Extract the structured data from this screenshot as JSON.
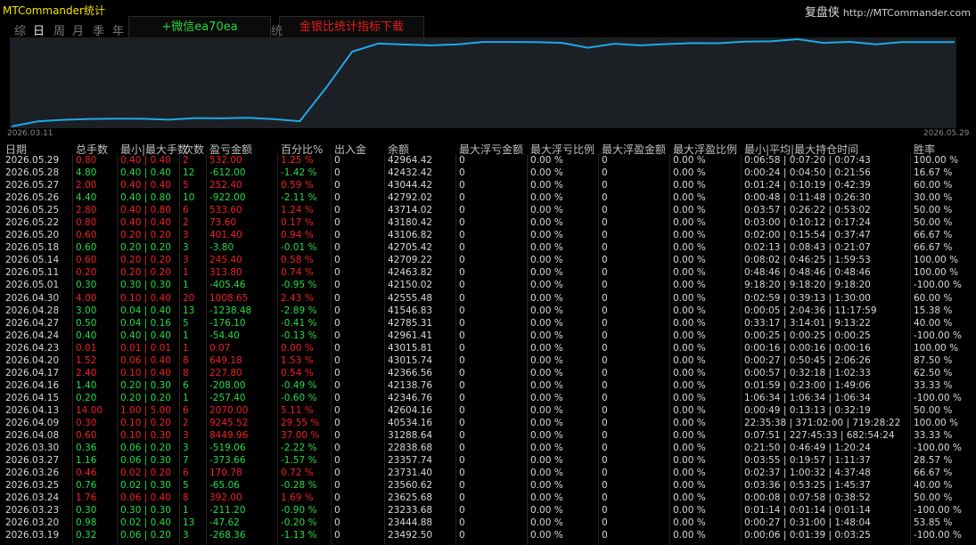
{
  "app": {
    "title": "MTCommander统计"
  },
  "brand": {
    "name": "复盘侠",
    "url": "http://MTCommander.com"
  },
  "period_tabs": [
    "综",
    "日",
    "周",
    "月",
    "季",
    "年"
  ],
  "active_tab": "日",
  "banners": {
    "wechat": "+微信ea70ea",
    "download": "金银比统计指标下载"
  },
  "hidden_tab_fragment": "统",
  "chart": {
    "start_date": "2026.03.11",
    "end_date": "2026.05.29",
    "line_color": "#1fa8e8"
  },
  "chart_data": {
    "type": "line",
    "x": [
      "2026.03.11",
      "2026.03.12",
      "2026.03.13",
      "2026.03.16",
      "2026.03.17",
      "2026.03.18",
      "2026.03.19",
      "2026.03.20",
      "2026.03.23",
      "2026.03.24",
      "2026.03.25",
      "2026.03.26",
      "2026.03.27",
      "2026.03.30",
      "2026.04.08",
      "2026.04.09",
      "2026.04.13",
      "2026.04.15",
      "2026.04.16",
      "2026.04.17",
      "2026.04.20",
      "2026.04.23",
      "2026.04.24",
      "2026.04.27",
      "2026.04.28",
      "2026.04.30",
      "2026.05.01",
      "2026.05.11",
      "2026.05.14",
      "2026.05.18",
      "2026.05.20",
      "2026.05.22",
      "2026.05.25",
      "2026.05.26",
      "2026.05.27",
      "2026.05.28",
      "2026.05.29"
    ],
    "series": [
      {
        "values": [
          21500,
          22800,
          23200,
          23400,
          23492,
          23445,
          23234,
          23626,
          23561,
          23731,
          23358,
          22839,
          31289,
          40534,
          42604,
          42347,
          42139,
          42367,
          43016,
          43016,
          42961,
          42785,
          41547,
          42555,
          42150,
          42464,
          42709,
          42705,
          43107,
          43181,
          43714,
          42792,
          43044,
          42432,
          42964,
          42964,
          42964
        ]
      }
    ],
    "xlabel": "",
    "ylabel": ""
  },
  "headers": [
    "日期",
    "总手数",
    "最小|最大手数",
    "次数",
    "盈亏金额",
    "百分比%",
    "出入金",
    "余额",
    "最大浮亏金额",
    "最大浮亏比例",
    "最大浮盈金额",
    "最大浮盈比例",
    "最小|平均|最大持仓时间",
    "胜率"
  ],
  "rows": [
    {
      "date": "2026.05.29",
      "lots": "0.80",
      "minmax": "0.40 | 0.40",
      "count": "2",
      "pnl": "532.00",
      "pct": "1.25 %",
      "io": "0",
      "balance": "42964.42",
      "mfl": "0",
      "mflp": "0.00 %",
      "mfp": "0",
      "mfpp": "0.00 %",
      "hold": "0:06:58 | 0:07:20 | 0:07:43",
      "win": "100.00 %",
      "dir": "up"
    },
    {
      "date": "2026.05.28",
      "lots": "4.80",
      "minmax": "0.40 | 0.40",
      "count": "12",
      "pnl": "-612.00",
      "pct": "-1.42 %",
      "io": "0",
      "balance": "42432.42",
      "mfl": "0",
      "mflp": "0.00 %",
      "mfp": "0",
      "mfpp": "0.00 %",
      "hold": "0:00:24 | 0:04:50 | 0:21:56",
      "win": "16.67 %",
      "dir": "down"
    },
    {
      "date": "2026.05.27",
      "lots": "2.00",
      "minmax": "0.40 | 0.40",
      "count": "5",
      "pnl": "252.40",
      "pct": "0.59 %",
      "io": "0",
      "balance": "43044.42",
      "mfl": "0",
      "mflp": "0.00 %",
      "mfp": "0",
      "mfpp": "0.00 %",
      "hold": "0:01:24 | 0:10:19 | 0:42:39",
      "win": "60.00 %",
      "dir": "up"
    },
    {
      "date": "2026.05.26",
      "lots": "4.40",
      "minmax": "0.40 | 0.80",
      "count": "10",
      "pnl": "-922.00",
      "pct": "-2.11 %",
      "io": "0",
      "balance": "42792.02",
      "mfl": "0",
      "mflp": "0.00 %",
      "mfp": "0",
      "mfpp": "0.00 %",
      "hold": "0:00:48 | 0:11:48 | 0:26:30",
      "win": "30.00 %",
      "dir": "down"
    },
    {
      "date": "2026.05.25",
      "lots": "2.80",
      "minmax": "0.40 | 0.80",
      "count": "6",
      "pnl": "533.60",
      "pct": "1.24 %",
      "io": "0",
      "balance": "43714.02",
      "mfl": "0",
      "mflp": "0.00 %",
      "mfp": "0",
      "mfpp": "0.00 %",
      "hold": "0:03:57 | 0:26:22 | 0:53:02",
      "win": "50.00 %",
      "dir": "up"
    },
    {
      "date": "2026.05.22",
      "lots": "0.80",
      "minmax": "0.40 | 0.40",
      "count": "2",
      "pnl": "73.60",
      "pct": "0.17 %",
      "io": "0",
      "balance": "43180.42",
      "mfl": "0",
      "mflp": "0.00 %",
      "mfp": "0",
      "mfpp": "0.00 %",
      "hold": "0:03:00 | 0:10:12 | 0:17:24",
      "win": "50.00 %",
      "dir": "up"
    },
    {
      "date": "2026.05.20",
      "lots": "0.60",
      "minmax": "0.20 | 0.20",
      "count": "3",
      "pnl": "401.40",
      "pct": "0.94 %",
      "io": "0",
      "balance": "43106.82",
      "mfl": "0",
      "mflp": "0.00 %",
      "mfp": "0",
      "mfpp": "0.00 %",
      "hold": "0:02:00 | 0:15:54 | 0:37:47",
      "win": "66.67 %",
      "dir": "up"
    },
    {
      "date": "2026.05.18",
      "lots": "0.60",
      "minmax": "0.20 | 0.20",
      "count": "3",
      "pnl": "-3.80",
      "pct": "-0.01 %",
      "io": "0",
      "balance": "42705.42",
      "mfl": "0",
      "mflp": "0.00 %",
      "mfp": "0",
      "mfpp": "0.00 %",
      "hold": "0:02:13 | 0:08:43 | 0:21:07",
      "win": "66.67 %",
      "dir": "down"
    },
    {
      "date": "2026.05.14",
      "lots": "0.60",
      "minmax": "0.20 | 0.20",
      "count": "3",
      "pnl": "245.40",
      "pct": "0.58 %",
      "io": "0",
      "balance": "42709.22",
      "mfl": "0",
      "mflp": "0.00 %",
      "mfp": "0",
      "mfpp": "0.00 %",
      "hold": "0:08:02 | 0:46:25 | 1:59:53",
      "win": "100.00 %",
      "dir": "up"
    },
    {
      "date": "2026.05.11",
      "lots": "0.20",
      "minmax": "0.20 | 0.20",
      "count": "1",
      "pnl": "313.80",
      "pct": "0.74 %",
      "io": "0",
      "balance": "42463.82",
      "mfl": "0",
      "mflp": "0.00 %",
      "mfp": "0",
      "mfpp": "0.00 %",
      "hold": "0:48:46 | 0:48:46 | 0:48:46",
      "win": "100.00 %",
      "dir": "up"
    },
    {
      "date": "2026.05.01",
      "lots": "0.30",
      "minmax": "0.30 | 0.30",
      "count": "1",
      "pnl": "-405.46",
      "pct": "-0.95 %",
      "io": "0",
      "balance": "42150.02",
      "mfl": "0",
      "mflp": "0.00 %",
      "mfp": "0",
      "mfpp": "0.00 %",
      "hold": "9:18:20 | 9:18:20 | 9:18:20",
      "win": "-100.00 %",
      "dir": "down"
    },
    {
      "date": "2026.04.30",
      "lots": "4.00",
      "minmax": "0.10 | 0.40",
      "count": "20",
      "pnl": "1008.65",
      "pct": "2.43 %",
      "io": "0",
      "balance": "42555.48",
      "mfl": "0",
      "mflp": "0.00 %",
      "mfp": "0",
      "mfpp": "0.00 %",
      "hold": "0:02:59 | 0:39:13 | 1:30:00",
      "win": "60.00 %",
      "dir": "up"
    },
    {
      "date": "2026.04.28",
      "lots": "3.00",
      "minmax": "0.04 | 0.40",
      "count": "13",
      "pnl": "-1238.48",
      "pct": "-2.89 %",
      "io": "0",
      "balance": "41546.83",
      "mfl": "0",
      "mflp": "0.00 %",
      "mfp": "0",
      "mfpp": "0.00 %",
      "hold": "0:00:05 | 2:04:36 | 11:17:59",
      "win": "15.38 %",
      "dir": "down"
    },
    {
      "date": "2026.04.27",
      "lots": "0.50",
      "minmax": "0.04 | 0.16",
      "count": "5",
      "pnl": "-176.10",
      "pct": "-0.41 %",
      "io": "0",
      "balance": "42785.31",
      "mfl": "0",
      "mflp": "0.00 %",
      "mfp": "0",
      "mfpp": "0.00 %",
      "hold": "0:33:17 | 3:14:01 | 9:13:22",
      "win": "40.00 %",
      "dir": "down"
    },
    {
      "date": "2026.04.24",
      "lots": "0.40",
      "minmax": "0.40 | 0.40",
      "count": "1",
      "pnl": "-54.40",
      "pct": "-0.13 %",
      "io": "0",
      "balance": "42961.41",
      "mfl": "0",
      "mflp": "0.00 %",
      "mfp": "0",
      "mfpp": "0.00 %",
      "hold": "0:00:25 | 0:00:25 | 0:00:25",
      "win": "-100.00 %",
      "dir": "down"
    },
    {
      "date": "2026.04.23",
      "lots": "0.01",
      "minmax": "0.01 | 0.01",
      "count": "1",
      "pnl": "0.07",
      "pct": "0.00 %",
      "io": "0",
      "balance": "43015.81",
      "mfl": "0",
      "mflp": "0.00 %",
      "mfp": "0",
      "mfpp": "0.00 %",
      "hold": "0:00:16 | 0:00:16 | 0:00:16",
      "win": "100.00 %",
      "dir": "up"
    },
    {
      "date": "2026.04.20",
      "lots": "1.52",
      "minmax": "0.06 | 0.40",
      "count": "8",
      "pnl": "649.18",
      "pct": "1.53 %",
      "io": "0",
      "balance": "43015.74",
      "mfl": "0",
      "mflp": "0.00 %",
      "mfp": "0",
      "mfpp": "0.00 %",
      "hold": "0:00:27 | 0:50:45 | 2:06:26",
      "win": "87.50 %",
      "dir": "up"
    },
    {
      "date": "2026.04.17",
      "lots": "2.40",
      "minmax": "0.10 | 0.40",
      "count": "8",
      "pnl": "227.80",
      "pct": "0.54 %",
      "io": "0",
      "balance": "42366.56",
      "mfl": "0",
      "mflp": "0.00 %",
      "mfp": "0",
      "mfpp": "0.00 %",
      "hold": "0:00:57 | 0:32:18 | 1:02:33",
      "win": "62.50 %",
      "dir": "up"
    },
    {
      "date": "2026.04.16",
      "lots": "1.40",
      "minmax": "0.20 | 0.30",
      "count": "6",
      "pnl": "-208.00",
      "pct": "-0.49 %",
      "io": "0",
      "balance": "42138.76",
      "mfl": "0",
      "mflp": "0.00 %",
      "mfp": "0",
      "mfpp": "0.00 %",
      "hold": "0:01:59 | 0:23:00 | 1:49:06",
      "win": "33.33 %",
      "dir": "down"
    },
    {
      "date": "2026.04.15",
      "lots": "0.20",
      "minmax": "0.20 | 0.20",
      "count": "1",
      "pnl": "-257.40",
      "pct": "-0.60 %",
      "io": "0",
      "balance": "42346.76",
      "mfl": "0",
      "mflp": "0.00 %",
      "mfp": "0",
      "mfpp": "0.00 %",
      "hold": "1:06:34 | 1:06:34 | 1:06:34",
      "win": "-100.00 %",
      "dir": "down"
    },
    {
      "date": "2026.04.13",
      "lots": "14.00",
      "minmax": "1.00 | 5.00",
      "count": "6",
      "pnl": "2070.00",
      "pct": "5.11 %",
      "io": "0",
      "balance": "42604.16",
      "mfl": "0",
      "mflp": "0.00 %",
      "mfp": "0",
      "mfpp": "0.00 %",
      "hold": "0:00:49 | 0:13:13 | 0:32:19",
      "win": "50.00 %",
      "dir": "up"
    },
    {
      "date": "2026.04.09",
      "lots": "0.30",
      "minmax": "0.10 | 0.20",
      "count": "2",
      "pnl": "9245.52",
      "pct": "29.55 %",
      "io": "0",
      "balance": "40534.16",
      "mfl": "0",
      "mflp": "0.00 %",
      "mfp": "0",
      "mfpp": "0.00 %",
      "hold": "22:35:38 | 371:02:00 | 719:28:22",
      "win": "100.00 %",
      "dir": "up"
    },
    {
      "date": "2026.04.08",
      "lots": "0.60",
      "minmax": "0.10 | 0.30",
      "count": "3",
      "pnl": "8449.96",
      "pct": "37.00 %",
      "io": "0",
      "balance": "31288.64",
      "mfl": "0",
      "mflp": "0.00 %",
      "mfp": "0",
      "mfpp": "0.00 %",
      "hold": "0:07:51 | 227:45:33 | 682:54:24",
      "win": "33.33 %",
      "dir": "up"
    },
    {
      "date": "2026.03.30",
      "lots": "0.36",
      "minmax": "0.06 | 0.20",
      "count": "3",
      "pnl": "-519.06",
      "pct": "-2.22 %",
      "io": "0",
      "balance": "22838.68",
      "mfl": "0",
      "mflp": "0.00 %",
      "mfp": "0",
      "mfpp": "0.00 %",
      "hold": "0:21:50 | 0:46:49 | 1:20:24",
      "win": "-100.00 %",
      "dir": "down"
    },
    {
      "date": "2026.03.27",
      "lots": "1.16",
      "minmax": "0.06 | 0.30",
      "count": "7",
      "pnl": "-373.66",
      "pct": "-1.57 %",
      "io": "0",
      "balance": "23357.74",
      "mfl": "0",
      "mflp": "0.00 %",
      "mfp": "0",
      "mfpp": "0.00 %",
      "hold": "0:03:55 | 0:19:57 | 1:11:37",
      "win": "28.57 %",
      "dir": "down"
    },
    {
      "date": "2026.03.26",
      "lots": "0.46",
      "minmax": "0.02 | 0.20",
      "count": "6",
      "pnl": "170.78",
      "pct": "0.72 %",
      "io": "0",
      "balance": "23731.40",
      "mfl": "0",
      "mflp": "0.00 %",
      "mfp": "0",
      "mfpp": "0.00 %",
      "hold": "0:02:37 | 1:00:32 | 4:37:48",
      "win": "66.67 %",
      "dir": "up"
    },
    {
      "date": "2026.03.25",
      "lots": "0.76",
      "minmax": "0.02 | 0.30",
      "count": "5",
      "pnl": "-65.06",
      "pct": "-0.28 %",
      "io": "0",
      "balance": "23560.62",
      "mfl": "0",
      "mflp": "0.00 %",
      "mfp": "0",
      "mfpp": "0.00 %",
      "hold": "0:03:36 | 0:53:25 | 1:45:37",
      "win": "40.00 %",
      "dir": "down"
    },
    {
      "date": "2026.03.24",
      "lots": "1.76",
      "minmax": "0.06 | 0.40",
      "count": "8",
      "pnl": "392.00",
      "pct": "1.69 %",
      "io": "0",
      "balance": "23625.68",
      "mfl": "0",
      "mflp": "0.00 %",
      "mfp": "0",
      "mfpp": "0.00 %",
      "hold": "0:00:08 | 0:07:58 | 0:38:52",
      "win": "50.00 %",
      "dir": "up"
    },
    {
      "date": "2026.03.23",
      "lots": "0.30",
      "minmax": "0.30 | 0.30",
      "count": "1",
      "pnl": "-211.20",
      "pct": "-0.90 %",
      "io": "0",
      "balance": "23233.68",
      "mfl": "0",
      "mflp": "0.00 %",
      "mfp": "0",
      "mfpp": "0.00 %",
      "hold": "0:01:14 | 0:01:14 | 0:01:14",
      "win": "-100.00 %",
      "dir": "down"
    },
    {
      "date": "2026.03.20",
      "lots": "0.98",
      "minmax": "0.02 | 0.40",
      "count": "13",
      "pnl": "-47.62",
      "pct": "-0.20 %",
      "io": "0",
      "balance": "23444.88",
      "mfl": "0",
      "mflp": "0.00 %",
      "mfp": "0",
      "mfpp": "0.00 %",
      "hold": "0:00:27 | 0:31:00 | 1:48:04",
      "win": "53.85 %",
      "dir": "down"
    },
    {
      "date": "2026.03.19",
      "lots": "0.32",
      "minmax": "0.06 | 0.20",
      "count": "3",
      "pnl": "-268.36",
      "pct": "-1.13 %",
      "io": "0",
      "balance": "23492.50",
      "mfl": "0",
      "mflp": "0.00 %",
      "mfp": "0",
      "mfpp": "0.00 %",
      "hold": "0:00:06 | 0:01:39 | 0:03:25",
      "win": "-100.00 %",
      "dir": "down"
    }
  ]
}
